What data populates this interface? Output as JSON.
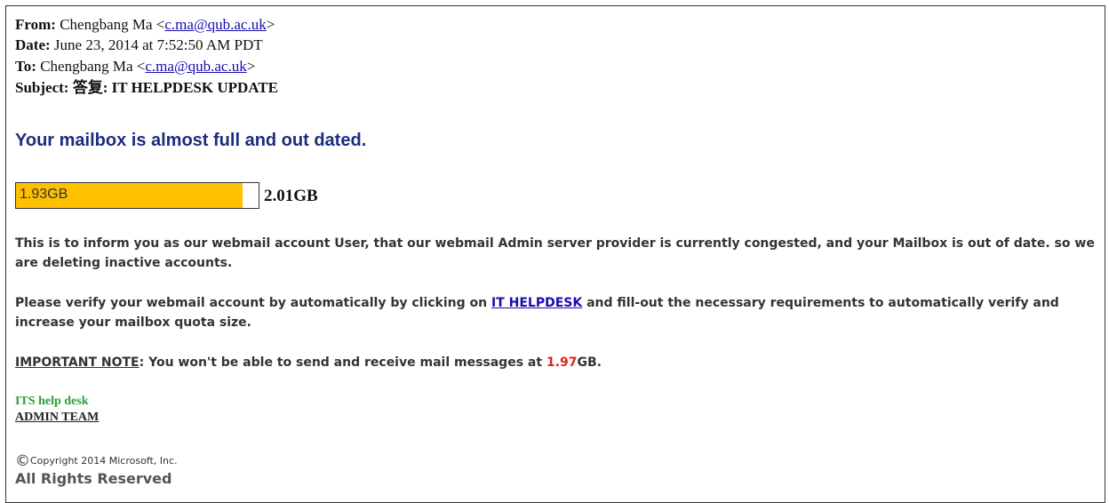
{
  "header": {
    "from_label": "From:",
    "from_name": "Chengbang Ma <",
    "from_email": "c.ma@qub.ac.uk",
    "from_close": ">",
    "date_label": "Date:",
    "date_value": "June 23, 2014 at 7:52:50 AM PDT",
    "to_label": "To:",
    "to_name": "Chengbang Ma <",
    "to_email": "c.ma@qub.ac.uk",
    "to_close": ">",
    "subject_label": "Subject:",
    "subject_value": "答复: IT HELPDESK UPDATE"
  },
  "body": {
    "title": "Your mailbox is almost full and out dated.",
    "quota": {
      "used_label": "1.93GB",
      "total_label": "2.01GB",
      "fill_fraction": 0.935,
      "fill_color": "#ffc000"
    },
    "para1": "This is to inform you as our webmail account User, that our webmail Admin server provider is currently congested, and your Mailbox is out of date. so we are deleting inactive accounts.",
    "para2_before": "Please verify your webmail account by automatically by clicking on ",
    "para2_link": "IT HELPDESK",
    "para2_after": " and fill-out the necessary requirements to automatically verify and increase your mailbox quota size.",
    "note_label": "IMPORTANT NOTE",
    "note_text": ": You won't be able to send and receive mail messages at ",
    "note_value": "1.97",
    "note_unit": "GB."
  },
  "signature": {
    "line1": "ITS help desk",
    "line2": "ADMIN TEAM"
  },
  "footer": {
    "copyright_symbol": "©",
    "copyright_text": "Copyright 2014 Microsoft, Inc.",
    "rights": "All Rights Reserved"
  },
  "colors": {
    "title": "#1c2d80",
    "link": "#1a0dab",
    "warning_value": "#e0221b",
    "signature": "#2a9d3a"
  }
}
